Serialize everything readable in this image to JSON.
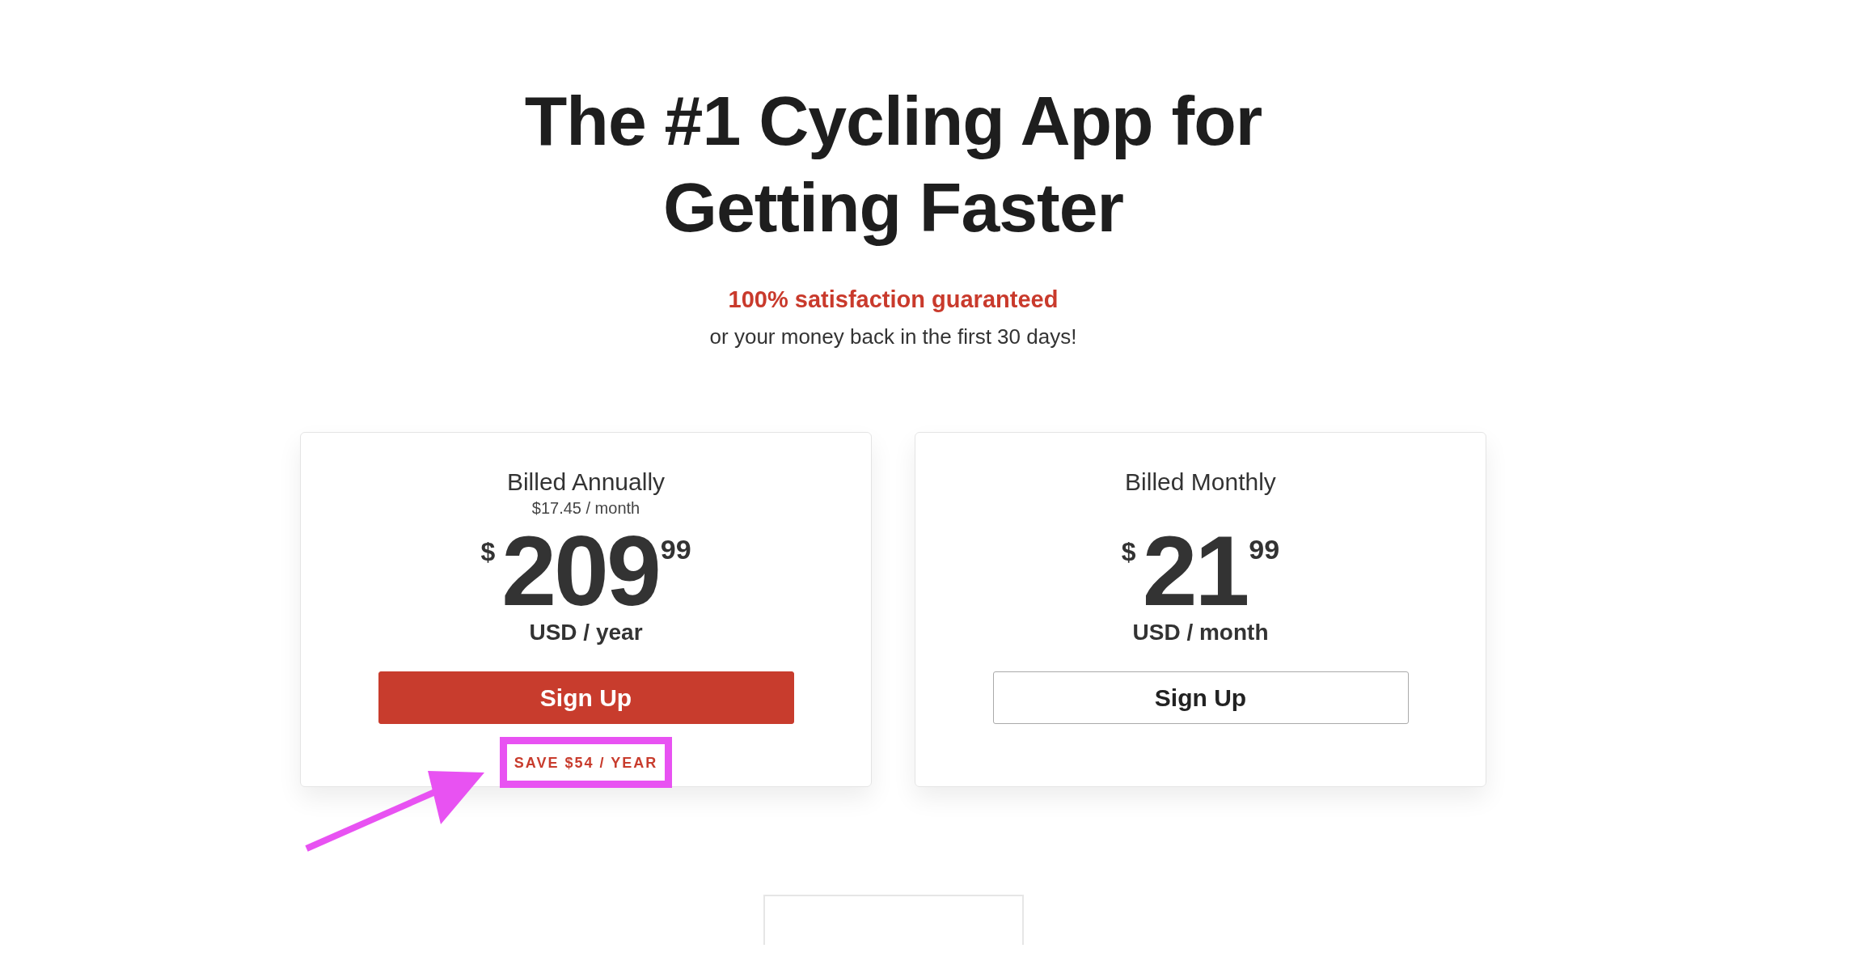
{
  "headline": {
    "lines": [
      "The #1 Cycling App for",
      "Getting Faster"
    ]
  },
  "guarantee": {
    "highlight": "100% satisfaction guaranteed",
    "detail": "or your money back in the first 30 days!"
  },
  "plans": [
    {
      "title": "Billed Annually",
      "monthly_equivalent": "$17.45 / month",
      "currency": "$",
      "amount": "209",
      "cents": "99",
      "period": "USD / year",
      "button": "Sign Up",
      "featured": true,
      "savings": "SAVE $54 / YEAR",
      "savings_highlighted": true
    },
    {
      "title": "Billed Monthly",
      "currency": "$",
      "amount": "21",
      "cents": "99",
      "period": "USD / month",
      "button": "Sign Up",
      "featured": false,
      "savings_highlighted": false
    }
  ]
}
